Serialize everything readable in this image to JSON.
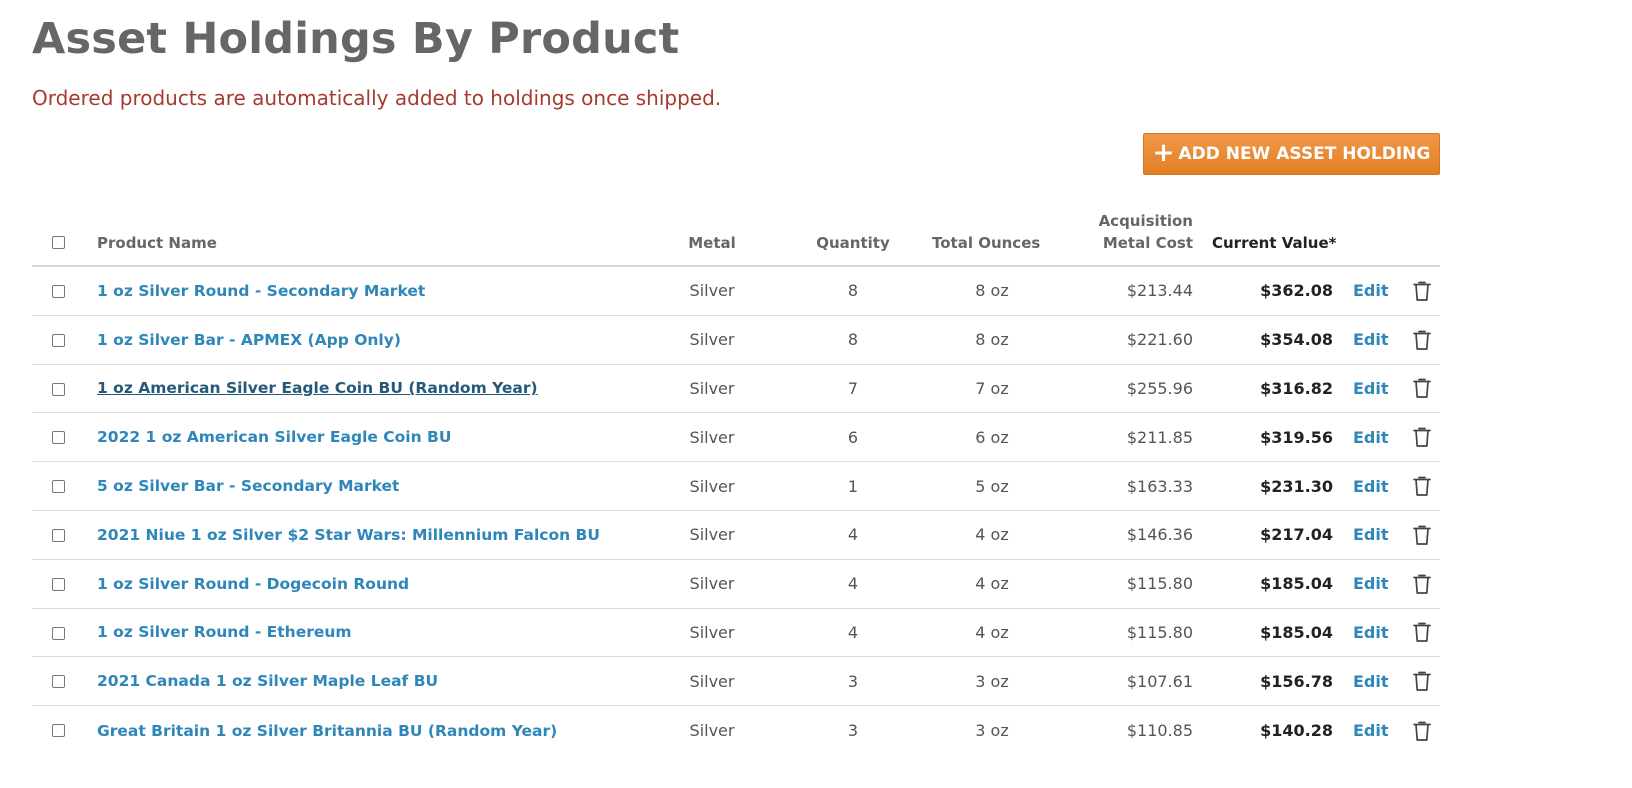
{
  "page": {
    "title": "Asset Holdings By Product",
    "notice": "Ordered products are automatically added to holdings once shipped.",
    "add_button_label": "ADD NEW ASSET HOLDING",
    "accent_color": "#ea8a33",
    "link_color": "#2f86b8",
    "notice_color": "#a63a2e"
  },
  "table": {
    "columns": {
      "product_name": "Product Name",
      "metal": "Metal",
      "quantity": "Quantity",
      "total_ounces": "Total Ounces",
      "acquisition_line1": "Acquisition",
      "acquisition_line2": "Metal Cost",
      "current_value": "Current Value*"
    },
    "edit_label": "Edit",
    "rows": [
      {
        "name": "1 oz Silver Round - Secondary Market",
        "metal": "Silver",
        "quantity": "8",
        "ounces": "8 oz",
        "cost": "$213.44",
        "value": "$362.08"
      },
      {
        "name": "1 oz Silver Bar - APMEX (App Only)",
        "metal": "Silver",
        "quantity": "8",
        "ounces": "8 oz",
        "cost": "$221.60",
        "value": "$354.08"
      },
      {
        "name": "1 oz American Silver Eagle Coin BU (Random Year)",
        "metal": "Silver",
        "quantity": "7",
        "ounces": "7 oz",
        "cost": "$255.96",
        "value": "$316.82"
      },
      {
        "name": "2022 1 oz American Silver Eagle Coin BU",
        "metal": "Silver",
        "quantity": "6",
        "ounces": "6 oz",
        "cost": "$211.85",
        "value": "$319.56"
      },
      {
        "name": "5 oz Silver Bar - Secondary Market",
        "metal": "Silver",
        "quantity": "1",
        "ounces": "5 oz",
        "cost": "$163.33",
        "value": "$231.30"
      },
      {
        "name": "2021 Niue 1 oz Silver $2 Star Wars: Millennium Falcon BU",
        "metal": "Silver",
        "quantity": "4",
        "ounces": "4 oz",
        "cost": "$146.36",
        "value": "$217.04"
      },
      {
        "name": "1 oz Silver Round - Dogecoin Round",
        "metal": "Silver",
        "quantity": "4",
        "ounces": "4 oz",
        "cost": "$115.80",
        "value": "$185.04"
      },
      {
        "name": "1 oz Silver Round - Ethereum",
        "metal": "Silver",
        "quantity": "4",
        "ounces": "4 oz",
        "cost": "$115.80",
        "value": "$185.04"
      },
      {
        "name": "2021 Canada 1 oz Silver Maple Leaf BU",
        "metal": "Silver",
        "quantity": "3",
        "ounces": "3 oz",
        "cost": "$107.61",
        "value": "$156.78"
      },
      {
        "name": "Great Britain 1 oz Silver Britannia BU (Random Year)",
        "metal": "Silver",
        "quantity": "3",
        "ounces": "3 oz",
        "cost": "$110.85",
        "value": "$140.28"
      }
    ]
  }
}
